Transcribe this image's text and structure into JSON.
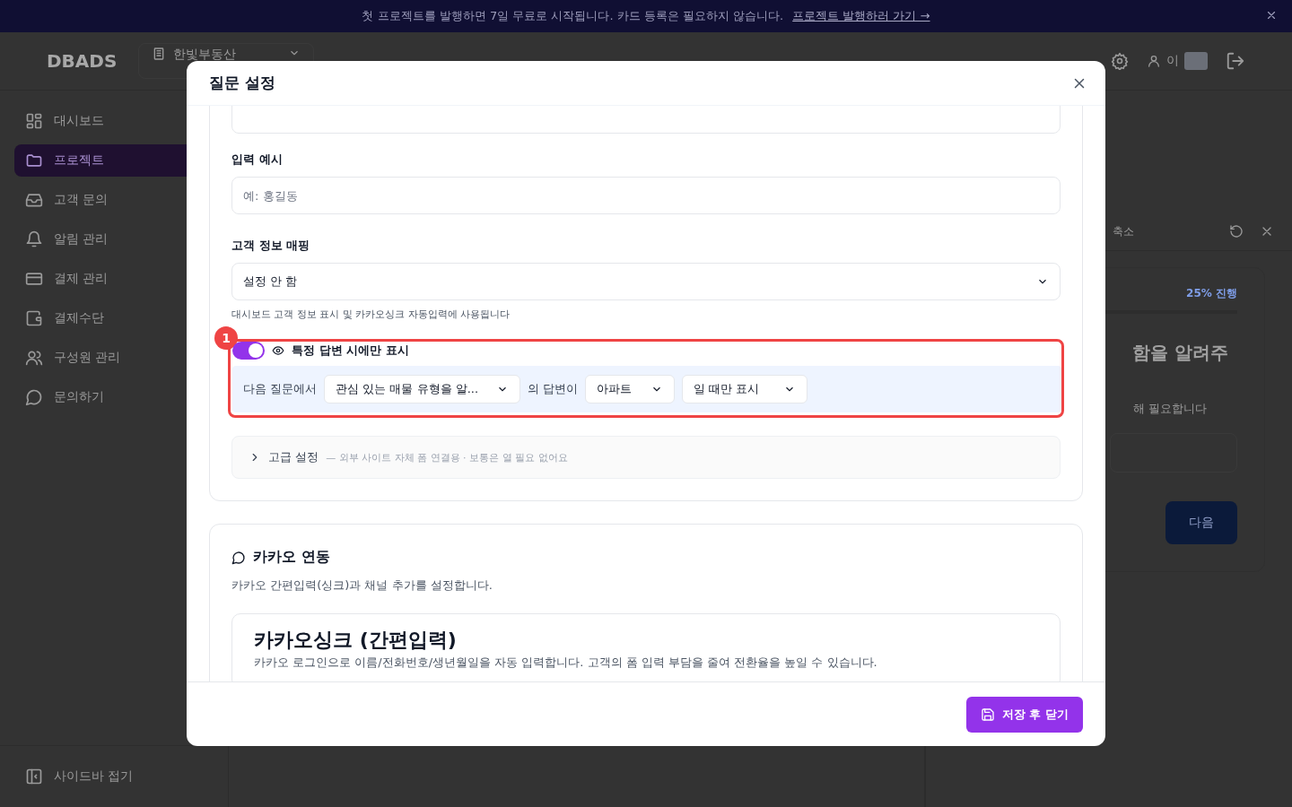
{
  "banner": {
    "text": "첫 프로젝트를 발행하면 7일 무료로 시작됩니다. 카드 등록은 필요하지 않습니다.",
    "link": "프로젝트 발행하러 가기 →"
  },
  "header": {
    "logo": "DBADS",
    "workspace": "한빛부동산",
    "user": "이"
  },
  "sidebar": {
    "items": [
      {
        "label": "대시보드",
        "selected": false
      },
      {
        "label": "프로젝트",
        "selected": true
      },
      {
        "label": "고객 문의",
        "selected": false
      },
      {
        "label": "알림 관리",
        "selected": false
      },
      {
        "label": "결제 관리",
        "selected": false
      },
      {
        "label": "결제수단",
        "selected": false
      },
      {
        "label": "구성원 관리",
        "selected": false
      },
      {
        "label": "문의하기",
        "selected": false
      }
    ],
    "collapse": "사이드바 접기"
  },
  "preview": {
    "collapse": "축소",
    "progress": "25% 진행",
    "heading": "함을 알려주",
    "subtext": "해 필요합니다",
    "next": "다음"
  },
  "dialog": {
    "title": "질문 설정",
    "example": {
      "label": "입력 예시",
      "placeholder": "예: 홍길동"
    },
    "mapping": {
      "label": "고객 정보 매핑",
      "value": "설정 안 함",
      "help": "대시보드 고객 정보 표시 및 카카오싱크 자동입력에 사용됩니다"
    },
    "condition": {
      "badge": "1",
      "enabled": true,
      "label": "특정 답변 시에만 표시",
      "prefix": "다음 질문에서",
      "question": "관심 있는 매물 유형을 알...",
      "middle": "의 답변이",
      "answer": "아파트",
      "mode": "일 때만 표시"
    },
    "advanced": {
      "expanded": false,
      "label": "고급 설정",
      "note": "— 외부 사이트 자체 폼 연결용 · 보통은 열 필요 없어요"
    },
    "kakao": {
      "title": "카카오 연동",
      "description": "카카오 간편입력(싱크)과 채널 추가를 설정합니다.",
      "sync_title": "카카오싱크 (간편입력)",
      "sync_description": "카카오 로그인으로 이름/전화번호/생년월일을 자동 입력합니다. 고객의 폼 입력 부담을 줄여 전환율을 높일 수 있습니다."
    },
    "save": "저장 후 닫기"
  }
}
